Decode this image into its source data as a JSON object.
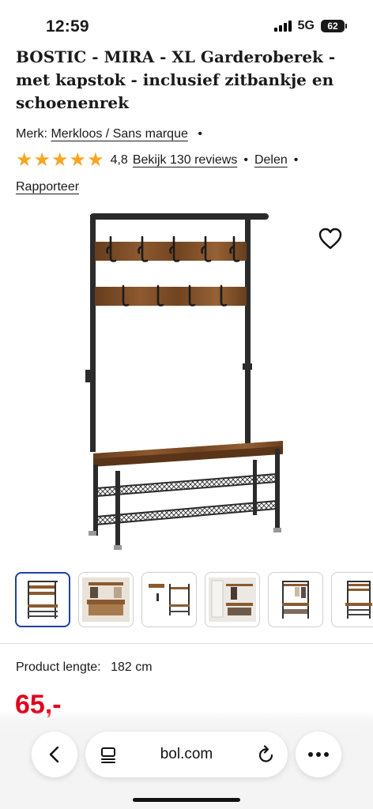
{
  "status_bar": {
    "time": "12:59",
    "network": "5G",
    "battery": "62"
  },
  "product": {
    "title": "BOSTIC - MIRA - XL Garderoberek - met kapstok - inclusief zitbankje en schoenenrek",
    "brand_label": "Merk:",
    "brand_link": "Merkloos / Sans marque",
    "rating": {
      "stars": 5,
      "value": "4,8"
    },
    "reviews_link": "Bekijk 130 reviews",
    "share_link": "Delen",
    "report_link": "Rapporteer",
    "separator": "•",
    "image_icon": "coat-rack-bench-product-image",
    "favorite_icon": "heart-outline-icon"
  },
  "thumbnails": [
    {
      "icon": "coat-rack-front",
      "selected": true
    },
    {
      "icon": "room-scene",
      "selected": false
    },
    {
      "icon": "dimensions-diagram",
      "selected": false
    },
    {
      "icon": "hallway-scene",
      "selected": false
    },
    {
      "icon": "coat-rack-with-items",
      "selected": false
    },
    {
      "icon": "coat-rack-side",
      "selected": false
    }
  ],
  "specs": {
    "label": "Product lengte:",
    "value": "182 cm"
  },
  "price": "65,-",
  "browser": {
    "url": "bol.com",
    "accent": "#e0001b",
    "selected_thumb_border": "#1f3fa6"
  }
}
